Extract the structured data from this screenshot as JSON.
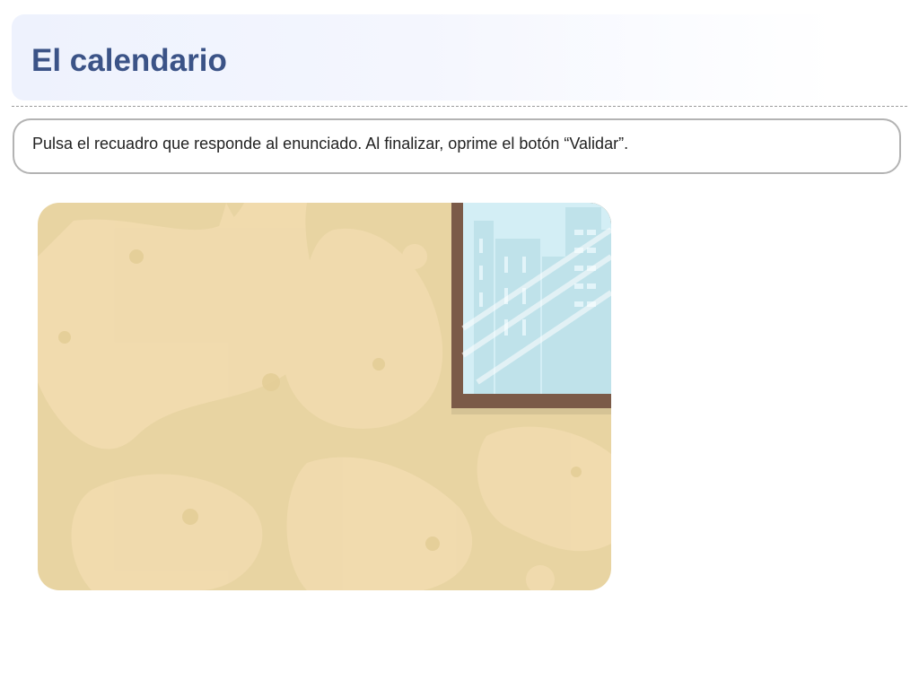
{
  "header": {
    "title": "El calendario"
  },
  "instructions": {
    "text": "Pulsa el recuadro que responde al enunciado. Al finalizar, oprime el botón “Validar”."
  },
  "colors": {
    "title": "#3b5387",
    "wall": "#e8d4a2",
    "wall_texture": "#f2dcb0",
    "window_frame": "#7b5a48",
    "window_glass": "#d3eef5",
    "window_buildings": "#bfe2ea"
  },
  "scene": {
    "icon": "wall-with-window-illustration"
  }
}
